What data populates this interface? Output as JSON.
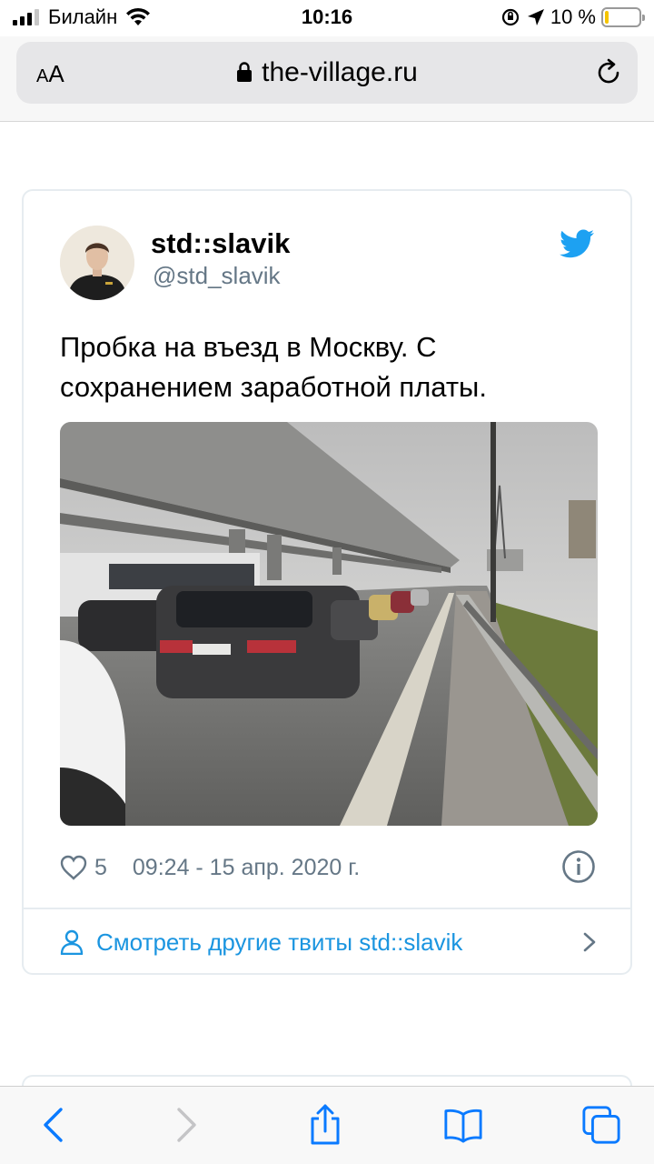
{
  "status_bar": {
    "carrier": "Билайн",
    "time": "10:16",
    "battery_text": "10 %",
    "battery_level": 0.1
  },
  "browser": {
    "text_size_label_small": "A",
    "text_size_label_large": "A",
    "url": "the-village.ru"
  },
  "tweet": {
    "author_name": "std::slavik",
    "author_handle": "@std_slavik",
    "text": "Пробка на въезд в Москву. С сохранением заработной платы.",
    "likes": "5",
    "timestamp": "09:24 - 15 апр. 2020 г.",
    "more_link": "Смотреть другие твиты std::slavik"
  },
  "colors": {
    "twitter_blue": "#1da1f2",
    "link_blue": "#1b95e0",
    "muted_text": "#657786",
    "ios_blue": "#0a7aff"
  },
  "icons": {
    "lock": "lock-icon",
    "reload": "reload-icon",
    "twitter": "twitter-bird-icon",
    "like": "heart-icon",
    "info": "info-icon",
    "profile": "person-icon",
    "chevron": "chevron-right-icon",
    "back": "back-arrow-icon",
    "forward": "forward-arrow-icon",
    "share": "share-icon",
    "bookmarks": "book-icon",
    "tabs": "tabs-icon"
  }
}
